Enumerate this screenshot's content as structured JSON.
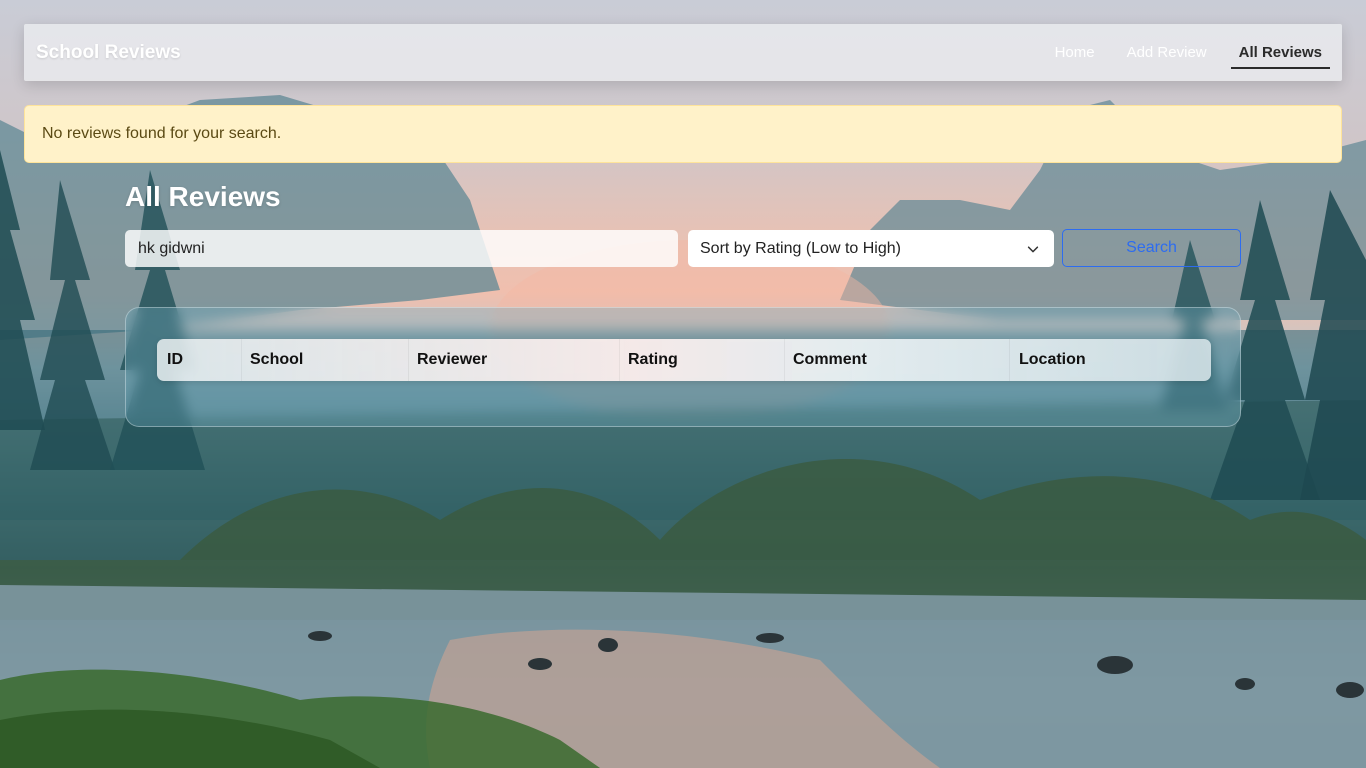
{
  "navbar": {
    "brand": "School Reviews",
    "links": [
      {
        "label": "Home",
        "active": false
      },
      {
        "label": "Add Review",
        "active": false
      },
      {
        "label": "All Reviews",
        "active": true
      }
    ]
  },
  "alert": {
    "message": "No reviews found for your search."
  },
  "page": {
    "title": "All Reviews"
  },
  "search": {
    "value": "hk gidwni",
    "sort_selected": "Sort by Rating (Low to High)",
    "button_label": "Search"
  },
  "table": {
    "columns": [
      "ID",
      "School",
      "Reviewer",
      "Rating",
      "Comment",
      "Location"
    ],
    "rows": []
  },
  "colors": {
    "accent": "#2d6cf0",
    "alert_bg": "#fff2c9",
    "alert_text": "#5b4a14"
  },
  "icons": {
    "sort_dropdown": "chevron-down-icon"
  }
}
